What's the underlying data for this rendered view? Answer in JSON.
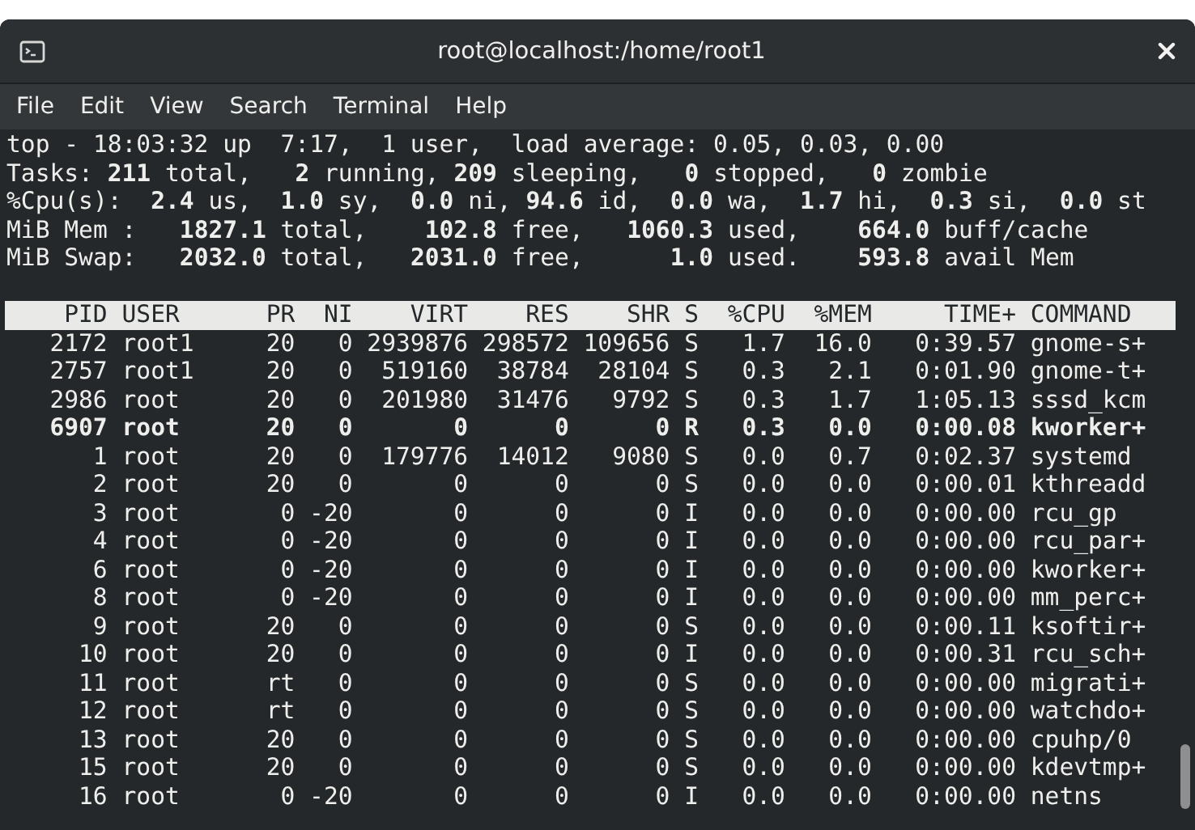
{
  "window": {
    "title": "root@localhost:/home/root1"
  },
  "menu": [
    "File",
    "Edit",
    "View",
    "Search",
    "Terminal",
    "Help"
  ],
  "summary": [
    "top - 18:03:32 up  7:17,  1 user,  load average: 0.05, 0.03, 0.00",
    "Tasks: **211** total,   **2** running, **209** sleeping,   **0** stopped,   **0** zombie",
    "%Cpu(s):  **2.4** us,  **1.0** sy,  **0.0** ni, **94.6** id,  **0.0** wa,  **1.7** hi,  **0.3** si,  **0.0** st",
    "MiB Mem :   **1827.1** total,    **102.8** free,   **1060.3** used,    **664.0** buff/cache",
    "MiB Swap:   **2032.0** total,   **2031.0** free,      **1.0** used.    **593.8** avail Mem"
  ],
  "process_table": {
    "columns": [
      "PID",
      "USER",
      "PR",
      "NI",
      "VIRT",
      "RES",
      "SHR",
      "S",
      "%CPU",
      "%MEM",
      "TIME+",
      "COMMAND"
    ],
    "rows": [
      {
        "highlighted": false,
        "cells": [
          "2172",
          "root1",
          "20",
          "0",
          "2939876",
          "298572",
          "109656",
          "S",
          "1.7",
          "16.0",
          "0:39.57",
          "gnome-s+"
        ]
      },
      {
        "highlighted": false,
        "cells": [
          "2757",
          "root1",
          "20",
          "0",
          "519160",
          "38784",
          "28104",
          "S",
          "0.3",
          "2.1",
          "0:01.90",
          "gnome-t+"
        ]
      },
      {
        "highlighted": false,
        "cells": [
          "2986",
          "root",
          "20",
          "0",
          "201980",
          "31476",
          "9792",
          "S",
          "0.3",
          "1.7",
          "1:05.13",
          "sssd_kcm"
        ]
      },
      {
        "highlighted": true,
        "cells": [
          "6907",
          "root",
          "20",
          "0",
          "0",
          "0",
          "0",
          "R",
          "0.3",
          "0.0",
          "0:00.08",
          "kworker+"
        ]
      },
      {
        "highlighted": false,
        "cells": [
          "1",
          "root",
          "20",
          "0",
          "179776",
          "14012",
          "9080",
          "S",
          "0.0",
          "0.7",
          "0:02.37",
          "systemd"
        ]
      },
      {
        "highlighted": false,
        "cells": [
          "2",
          "root",
          "20",
          "0",
          "0",
          "0",
          "0",
          "S",
          "0.0",
          "0.0",
          "0:00.01",
          "kthreadd"
        ]
      },
      {
        "highlighted": false,
        "cells": [
          "3",
          "root",
          "0",
          "-20",
          "0",
          "0",
          "0",
          "I",
          "0.0",
          "0.0",
          "0:00.00",
          "rcu_gp"
        ]
      },
      {
        "highlighted": false,
        "cells": [
          "4",
          "root",
          "0",
          "-20",
          "0",
          "0",
          "0",
          "I",
          "0.0",
          "0.0",
          "0:00.00",
          "rcu_par+"
        ]
      },
      {
        "highlighted": false,
        "cells": [
          "6",
          "root",
          "0",
          "-20",
          "0",
          "0",
          "0",
          "I",
          "0.0",
          "0.0",
          "0:00.00",
          "kworker+"
        ]
      },
      {
        "highlighted": false,
        "cells": [
          "8",
          "root",
          "0",
          "-20",
          "0",
          "0",
          "0",
          "I",
          "0.0",
          "0.0",
          "0:00.00",
          "mm_perc+"
        ]
      },
      {
        "highlighted": false,
        "cells": [
          "9",
          "root",
          "20",
          "0",
          "0",
          "0",
          "0",
          "S",
          "0.0",
          "0.0",
          "0:00.11",
          "ksoftir+"
        ]
      },
      {
        "highlighted": false,
        "cells": [
          "10",
          "root",
          "20",
          "0",
          "0",
          "0",
          "0",
          "I",
          "0.0",
          "0.0",
          "0:00.31",
          "rcu_sch+"
        ]
      },
      {
        "highlighted": false,
        "cells": [
          "11",
          "root",
          "rt",
          "0",
          "0",
          "0",
          "0",
          "S",
          "0.0",
          "0.0",
          "0:00.00",
          "migrati+"
        ]
      },
      {
        "highlighted": false,
        "cells": [
          "12",
          "root",
          "rt",
          "0",
          "0",
          "0",
          "0",
          "S",
          "0.0",
          "0.0",
          "0:00.00",
          "watchdo+"
        ]
      },
      {
        "highlighted": false,
        "cells": [
          "13",
          "root",
          "20",
          "0",
          "0",
          "0",
          "0",
          "S",
          "0.0",
          "0.0",
          "0:00.00",
          "cpuhp/0"
        ]
      },
      {
        "highlighted": false,
        "cells": [
          "15",
          "root",
          "20",
          "0",
          "0",
          "0",
          "0",
          "S",
          "0.0",
          "0.0",
          "0:00.00",
          "kdevtmp+"
        ]
      },
      {
        "highlighted": false,
        "cells": [
          "16",
          "root",
          "0",
          "-20",
          "0",
          "0",
          "0",
          "I",
          "0.0",
          "0.0",
          "0:00.00",
          "netns"
        ]
      }
    ]
  }
}
